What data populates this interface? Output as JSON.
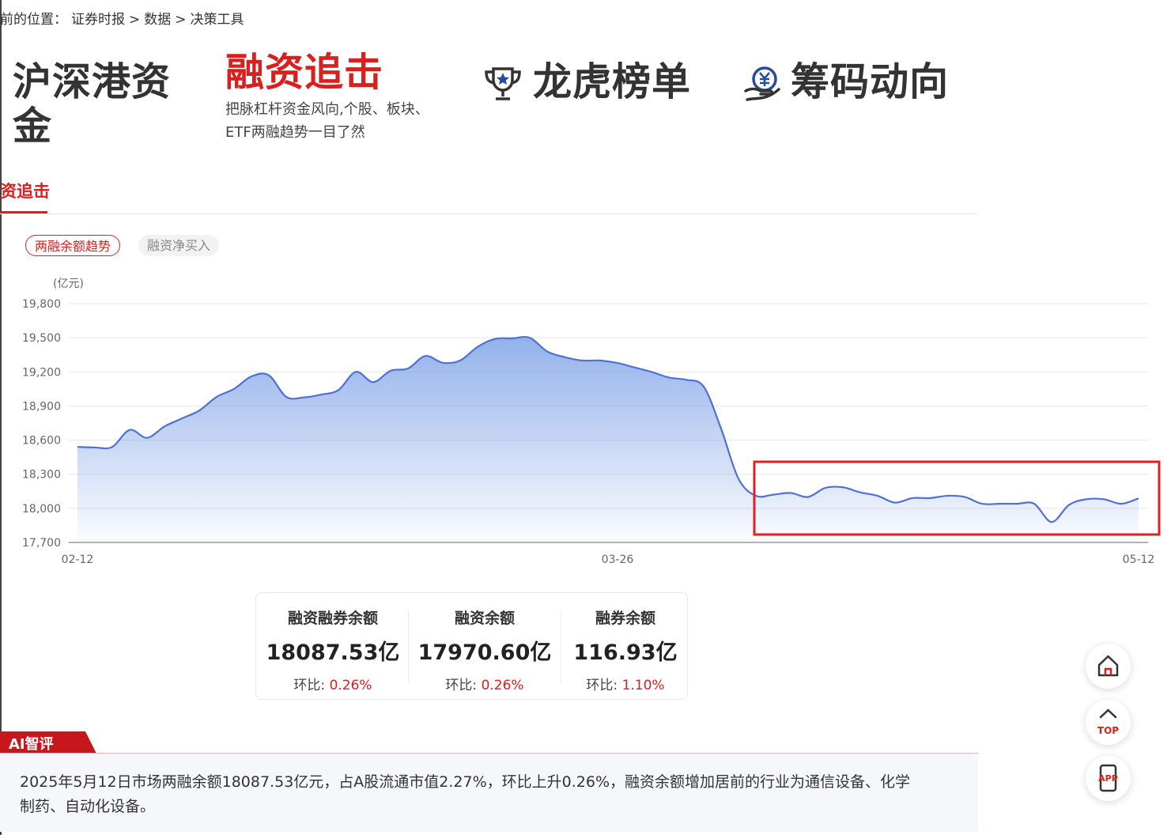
{
  "breadcrumb": {
    "prefix": "前的位置：",
    "items": [
      "证券时报",
      "数据",
      "决策工具"
    ],
    "separator": ">"
  },
  "nav": {
    "hk_connect": {
      "title_line1": "沪深港资",
      "title_line2": "金"
    },
    "margin": {
      "title": "融资追击",
      "sub_line1": "把脉杠杆资金风向,个股、板块、",
      "sub_line2": "ETF两融趋势一目了然"
    },
    "dragon_tiger": {
      "title": "龙虎榜单",
      "icon": "trophy-icon"
    },
    "chips": {
      "title": "筹码动向",
      "icon": "yuan-hand-icon"
    }
  },
  "tab": {
    "active_label": "资追击"
  },
  "pills": {
    "balance_trend": "两融余额趋势",
    "net_buy": "融资净买入"
  },
  "chart_data": {
    "type": "area",
    "ylabel": "(亿元)",
    "ylim": [
      17700,
      19800
    ],
    "yticks": [
      17700,
      18000,
      18300,
      18600,
      18900,
      19200,
      19500,
      19800
    ],
    "ytick_labels": [
      "17,700",
      "18,000",
      "18,300",
      "18,600",
      "18,900",
      "19,200",
      "19,500",
      "19,800"
    ],
    "x_tick_labels": [
      "02-12",
      "03-26",
      "05-12"
    ],
    "series": [
      {
        "values": [
          18540,
          18535,
          18540,
          18690,
          18620,
          18720,
          18790,
          18860,
          18980,
          19050,
          19160,
          19170,
          18980,
          18975,
          19000,
          19040,
          19200,
          19110,
          19210,
          19230,
          19340,
          19280,
          19300,
          19420,
          19490,
          19495,
          19500,
          19380,
          19330,
          19300,
          19300,
          19280,
          19240,
          19200,
          19150,
          19130,
          19070,
          18700,
          18260,
          18110,
          18120,
          18135,
          18100,
          18180,
          18185,
          18140,
          18110,
          18050,
          18090,
          18090,
          18110,
          18100,
          18040,
          18040,
          18040,
          18040,
          17880,
          18030,
          18080,
          18080,
          18040,
          18087.53
        ]
      }
    ],
    "line_color": "#4f71d6",
    "highlight_box_color": "#e02020",
    "highlight_range": [
      "after 03-26 drop",
      "05-12"
    ],
    "grid": true
  },
  "stats": [
    {
      "label": "融资融券余额",
      "value": "18087.53亿",
      "change_label": "环比:",
      "change": "0.26%"
    },
    {
      "label": "融资余额",
      "value": "17970.60亿",
      "change_label": "环比:",
      "change": "0.26%"
    },
    {
      "label": "融券余额",
      "value": "116.93亿",
      "change_label": "环比:",
      "change": "1.10%"
    }
  ],
  "ai": {
    "tag": "AI智评",
    "text": "2025年5月12日市场两融余额18087.53亿元，占A股流通市值2.27%，环比上升0.26%，融资余额增加居前的行业为通信设备、化学制药、自动化设备。"
  },
  "float_buttons": {
    "home_icon": "home-icon",
    "top_label": "TOP",
    "app_label": "APP"
  },
  "colors": {
    "accent": "#d9201e",
    "line": "#4f71d6"
  }
}
